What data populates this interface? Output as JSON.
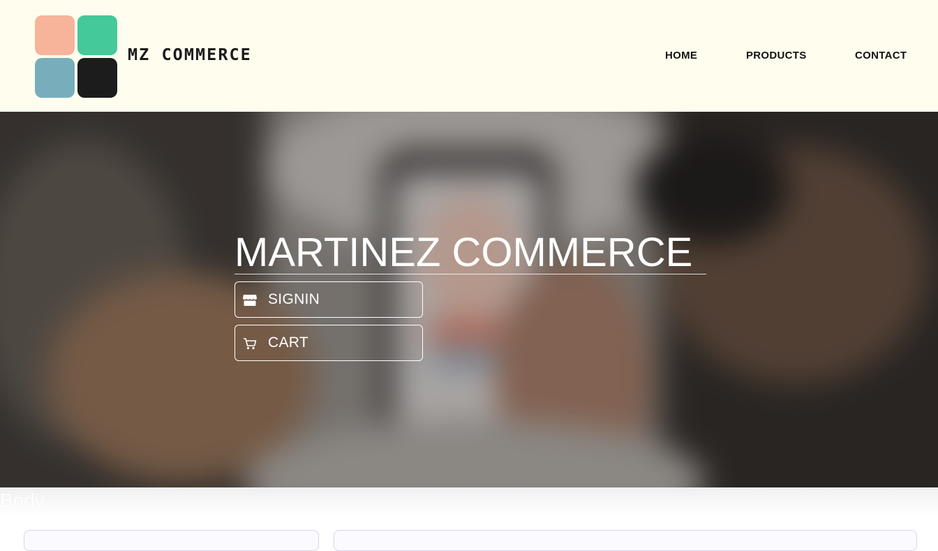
{
  "brand": {
    "name": "MZ COMMERCE",
    "logo_colors": [
      "#f8b39b",
      "#43c99a",
      "#78aebc",
      "#1c1c1c"
    ]
  },
  "nav": {
    "items": [
      {
        "label": "HOME"
      },
      {
        "label": "PRODUCTS"
      },
      {
        "label": "CONTACT"
      }
    ]
  },
  "hero": {
    "title": "MARTINEZ COMMERCE",
    "buttons": [
      {
        "label": "SIGNIN",
        "icon": "store-icon"
      },
      {
        "label": "CART",
        "icon": "cart-icon"
      }
    ]
  },
  "body": {
    "label": "Body"
  },
  "colors": {
    "header_bg": "#fffeee",
    "hero_text": "#ffffff"
  }
}
